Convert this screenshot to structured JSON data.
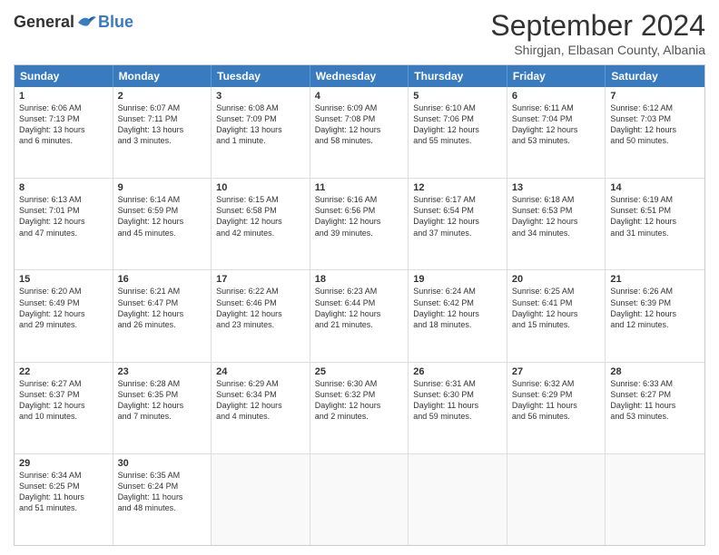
{
  "logo": {
    "general": "General",
    "blue": "Blue"
  },
  "title": "September 2024",
  "location": "Shirgjan, Elbasan County, Albania",
  "header_days": [
    "Sunday",
    "Monday",
    "Tuesday",
    "Wednesday",
    "Thursday",
    "Friday",
    "Saturday"
  ],
  "rows": [
    [
      {
        "day": "1",
        "lines": [
          "Sunrise: 6:06 AM",
          "Sunset: 7:13 PM",
          "Daylight: 13 hours",
          "and 6 minutes."
        ]
      },
      {
        "day": "2",
        "lines": [
          "Sunrise: 6:07 AM",
          "Sunset: 7:11 PM",
          "Daylight: 13 hours",
          "and 3 minutes."
        ]
      },
      {
        "day": "3",
        "lines": [
          "Sunrise: 6:08 AM",
          "Sunset: 7:09 PM",
          "Daylight: 13 hours",
          "and 1 minute."
        ]
      },
      {
        "day": "4",
        "lines": [
          "Sunrise: 6:09 AM",
          "Sunset: 7:08 PM",
          "Daylight: 12 hours",
          "and 58 minutes."
        ]
      },
      {
        "day": "5",
        "lines": [
          "Sunrise: 6:10 AM",
          "Sunset: 7:06 PM",
          "Daylight: 12 hours",
          "and 55 minutes."
        ]
      },
      {
        "day": "6",
        "lines": [
          "Sunrise: 6:11 AM",
          "Sunset: 7:04 PM",
          "Daylight: 12 hours",
          "and 53 minutes."
        ]
      },
      {
        "day": "7",
        "lines": [
          "Sunrise: 6:12 AM",
          "Sunset: 7:03 PM",
          "Daylight: 12 hours",
          "and 50 minutes."
        ]
      }
    ],
    [
      {
        "day": "8",
        "lines": [
          "Sunrise: 6:13 AM",
          "Sunset: 7:01 PM",
          "Daylight: 12 hours",
          "and 47 minutes."
        ]
      },
      {
        "day": "9",
        "lines": [
          "Sunrise: 6:14 AM",
          "Sunset: 6:59 PM",
          "Daylight: 12 hours",
          "and 45 minutes."
        ]
      },
      {
        "day": "10",
        "lines": [
          "Sunrise: 6:15 AM",
          "Sunset: 6:58 PM",
          "Daylight: 12 hours",
          "and 42 minutes."
        ]
      },
      {
        "day": "11",
        "lines": [
          "Sunrise: 6:16 AM",
          "Sunset: 6:56 PM",
          "Daylight: 12 hours",
          "and 39 minutes."
        ]
      },
      {
        "day": "12",
        "lines": [
          "Sunrise: 6:17 AM",
          "Sunset: 6:54 PM",
          "Daylight: 12 hours",
          "and 37 minutes."
        ]
      },
      {
        "day": "13",
        "lines": [
          "Sunrise: 6:18 AM",
          "Sunset: 6:53 PM",
          "Daylight: 12 hours",
          "and 34 minutes."
        ]
      },
      {
        "day": "14",
        "lines": [
          "Sunrise: 6:19 AM",
          "Sunset: 6:51 PM",
          "Daylight: 12 hours",
          "and 31 minutes."
        ]
      }
    ],
    [
      {
        "day": "15",
        "lines": [
          "Sunrise: 6:20 AM",
          "Sunset: 6:49 PM",
          "Daylight: 12 hours",
          "and 29 minutes."
        ]
      },
      {
        "day": "16",
        "lines": [
          "Sunrise: 6:21 AM",
          "Sunset: 6:47 PM",
          "Daylight: 12 hours",
          "and 26 minutes."
        ]
      },
      {
        "day": "17",
        "lines": [
          "Sunrise: 6:22 AM",
          "Sunset: 6:46 PM",
          "Daylight: 12 hours",
          "and 23 minutes."
        ]
      },
      {
        "day": "18",
        "lines": [
          "Sunrise: 6:23 AM",
          "Sunset: 6:44 PM",
          "Daylight: 12 hours",
          "and 21 minutes."
        ]
      },
      {
        "day": "19",
        "lines": [
          "Sunrise: 6:24 AM",
          "Sunset: 6:42 PM",
          "Daylight: 12 hours",
          "and 18 minutes."
        ]
      },
      {
        "day": "20",
        "lines": [
          "Sunrise: 6:25 AM",
          "Sunset: 6:41 PM",
          "Daylight: 12 hours",
          "and 15 minutes."
        ]
      },
      {
        "day": "21",
        "lines": [
          "Sunrise: 6:26 AM",
          "Sunset: 6:39 PM",
          "Daylight: 12 hours",
          "and 12 minutes."
        ]
      }
    ],
    [
      {
        "day": "22",
        "lines": [
          "Sunrise: 6:27 AM",
          "Sunset: 6:37 PM",
          "Daylight: 12 hours",
          "and 10 minutes."
        ]
      },
      {
        "day": "23",
        "lines": [
          "Sunrise: 6:28 AM",
          "Sunset: 6:35 PM",
          "Daylight: 12 hours",
          "and 7 minutes."
        ]
      },
      {
        "day": "24",
        "lines": [
          "Sunrise: 6:29 AM",
          "Sunset: 6:34 PM",
          "Daylight: 12 hours",
          "and 4 minutes."
        ]
      },
      {
        "day": "25",
        "lines": [
          "Sunrise: 6:30 AM",
          "Sunset: 6:32 PM",
          "Daylight: 12 hours",
          "and 2 minutes."
        ]
      },
      {
        "day": "26",
        "lines": [
          "Sunrise: 6:31 AM",
          "Sunset: 6:30 PM",
          "Daylight: 11 hours",
          "and 59 minutes."
        ]
      },
      {
        "day": "27",
        "lines": [
          "Sunrise: 6:32 AM",
          "Sunset: 6:29 PM",
          "Daylight: 11 hours",
          "and 56 minutes."
        ]
      },
      {
        "day": "28",
        "lines": [
          "Sunrise: 6:33 AM",
          "Sunset: 6:27 PM",
          "Daylight: 11 hours",
          "and 53 minutes."
        ]
      }
    ],
    [
      {
        "day": "29",
        "lines": [
          "Sunrise: 6:34 AM",
          "Sunset: 6:25 PM",
          "Daylight: 11 hours",
          "and 51 minutes."
        ]
      },
      {
        "day": "30",
        "lines": [
          "Sunrise: 6:35 AM",
          "Sunset: 6:24 PM",
          "Daylight: 11 hours",
          "and 48 minutes."
        ]
      },
      {
        "day": "",
        "lines": []
      },
      {
        "day": "",
        "lines": []
      },
      {
        "day": "",
        "lines": []
      },
      {
        "day": "",
        "lines": []
      },
      {
        "day": "",
        "lines": []
      }
    ]
  ]
}
